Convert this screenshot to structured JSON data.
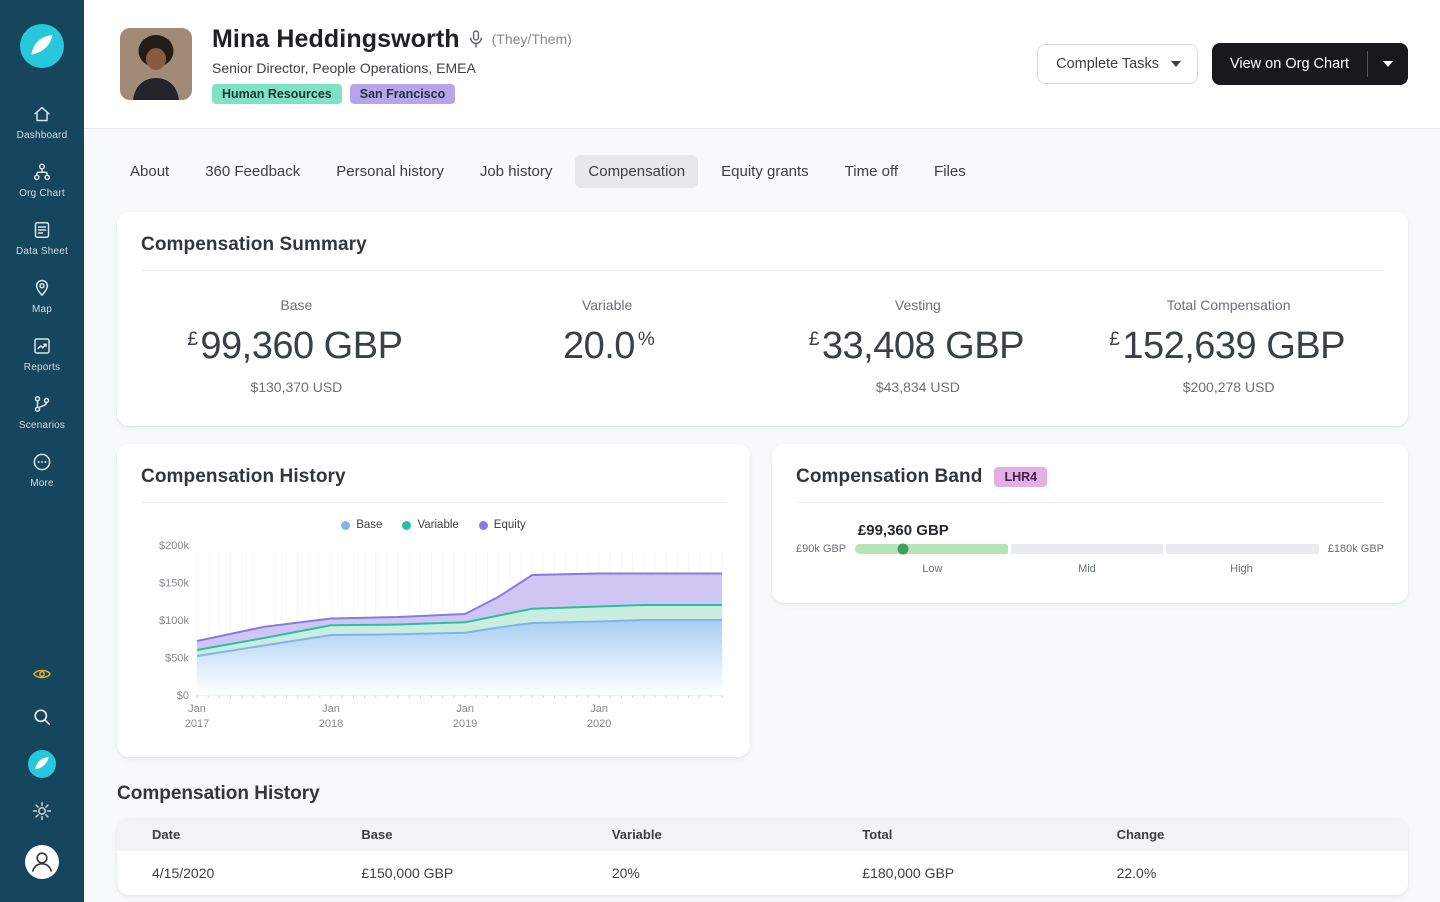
{
  "sidebar": {
    "items": [
      {
        "label": "Dashboard"
      },
      {
        "label": "Org Chart"
      },
      {
        "label": "Data Sheet"
      },
      {
        "label": "Map"
      },
      {
        "label": "Reports"
      },
      {
        "label": "Scenarios"
      },
      {
        "label": "More"
      }
    ]
  },
  "header": {
    "name": "Mina Heddingsworth",
    "pronouns": "(They/Them)",
    "job_title": "Senior Director, People Operations, EMEA",
    "tags": [
      {
        "label": "Human Resources",
        "bg": "#7de3c3"
      },
      {
        "label": "San Francisco",
        "bg": "#b5a5ec"
      }
    ],
    "complete_tasks_label": "Complete Tasks",
    "view_org_chart_label": "View on Org Chart"
  },
  "tabs": [
    {
      "label": "About"
    },
    {
      "label": "360 Feedback"
    },
    {
      "label": "Personal history"
    },
    {
      "label": "Job history"
    },
    {
      "label": "Compensation",
      "active": true
    },
    {
      "label": "Equity grants"
    },
    {
      "label": "Time off"
    },
    {
      "label": "Files"
    }
  ],
  "summary": {
    "title": "Compensation Summary",
    "columns": [
      {
        "label": "Base",
        "prefix": "£",
        "value": "99,360 GBP",
        "suffix": "",
        "sub": "$130,370 USD"
      },
      {
        "label": "Variable",
        "prefix": "",
        "value": "20.0",
        "suffix": "%",
        "sub": ""
      },
      {
        "label": "Vesting",
        "prefix": "£",
        "value": "33,408 GBP",
        "suffix": "",
        "sub": "$43,834 USD"
      },
      {
        "label": "Total Compensation",
        "prefix": "£",
        "value": "152,639 GBP",
        "suffix": "",
        "sub": "$200,278 USD"
      }
    ]
  },
  "history_card": {
    "title": "Compensation History"
  },
  "band_card": {
    "title": "Compensation Band",
    "badge": "LHR4",
    "value_label": "£99,360 GBP",
    "value": 99360,
    "min": 90000,
    "max": 180000,
    "min_label": "£90k GBP",
    "max_label": "£180k GBP",
    "segments": [
      "Low",
      "Mid",
      "High"
    ],
    "colors": {
      "fill": "#b5e4b7",
      "marker": "#3fa05a",
      "track": "#e9ebee"
    }
  },
  "table_section": {
    "title": "Compensation History",
    "headers": [
      "Date",
      "Base",
      "Variable",
      "Total",
      "Change"
    ],
    "rows": [
      [
        "4/15/2020",
        "£150,000 GBP",
        "20%",
        "£180,000 GBP",
        "22.0%"
      ]
    ]
  },
  "chart_data": {
    "type": "area",
    "stacked": true,
    "title": "Compensation History",
    "unit": "USD thousands",
    "x_months_from_jan2017": [
      0,
      6,
      12,
      18,
      24,
      27,
      30,
      36,
      40,
      47
    ],
    "series": [
      {
        "name": "Base",
        "color": "#7fb5ec",
        "fill": "gradient",
        "values": [
          52,
          66,
          80,
          81,
          83,
          90,
          96,
          98,
          100,
          100
        ]
      },
      {
        "name": "Variable",
        "color": "#2abfa4",
        "fill": "#c7ecdd",
        "values": [
          8,
          10,
          13,
          13,
          14,
          16,
          19,
          20,
          20,
          20
        ]
      },
      {
        "name": "Equity",
        "color": "#8a79e0",
        "fill": "#ccc3f2",
        "values": [
          12,
          15,
          9,
          10,
          11,
          25,
          45,
          44,
          42,
          42
        ]
      }
    ],
    "x_tick_months": [
      0,
      12,
      24,
      36
    ],
    "x_tick_labels": [
      [
        "Jan",
        "2017"
      ],
      [
        "Jan",
        "2018"
      ],
      [
        "Jan",
        "2019"
      ],
      [
        "Jan",
        "2020"
      ]
    ],
    "y_ticks": [
      "$0",
      "$50k",
      "$100k",
      "$150k",
      "$200k"
    ],
    "y_tick_values": [
      0,
      50,
      100,
      150,
      200
    ],
    "ylim": [
      0,
      200
    ],
    "legend_position": "top",
    "grid": "monthly-vertical-ticks"
  }
}
